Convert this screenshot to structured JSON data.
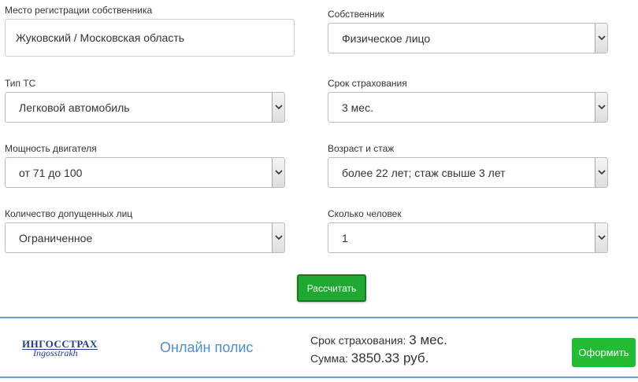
{
  "form": {
    "owner_reg_label": "Место регистрации собственника",
    "owner_reg_value": "Жуковский / Московская область",
    "owner_label": "Собственник",
    "owner_value": "Физическое лицо",
    "vehicle_type_label": "Тип ТС",
    "vehicle_type_value": "Легковой автомобиль",
    "term_label": "Срок страхования",
    "term_value": "3 мес.",
    "power_label": "Мощность двигателя",
    "power_value": "от 71 до 100",
    "age_exp_label": "Возраст и стаж",
    "age_exp_value": "более 22 лет; стаж свыше 3 лет",
    "drivers_count_label": "Количество допущенных лиц",
    "drivers_count_value": "Ограниченное",
    "persons_label": "Сколько человек",
    "persons_value": "1",
    "calculate_label": "Рассчитать"
  },
  "offer": {
    "logo_line1": "ИНГОССТРАХ",
    "logo_line2": "Ingosstrakh",
    "online_label": "Онлайн полис",
    "term_label": "Срок страхования:",
    "term_value": "3 мес.",
    "sum_label": "Сумма:",
    "sum_value": "3850.33 руб.",
    "order_label": "Оформить"
  },
  "colors": {
    "calc_button": "#1fa832",
    "order_button": "#22bb33",
    "offer_border": "#6a9fd3",
    "online_text": "#4d8ed1",
    "logo": "#1c3f87"
  },
  "icons": {
    "select_arrow": "chevron-down-icon"
  }
}
